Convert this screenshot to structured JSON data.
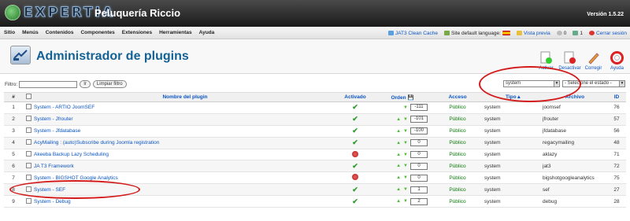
{
  "app": {
    "logo_text": "EXPERTIA",
    "site_name": "Peluquería Riccio",
    "version": "Versión 1.5.22"
  },
  "menu": [
    "Sitio",
    "Menús",
    "Contenidos",
    "Componentes",
    "Extensiones",
    "Herramientas",
    "Ayuda"
  ],
  "status": {
    "clean_cache": "JAT3 Clean Cache",
    "default_language": "Site default language:",
    "preview": "Vista previa",
    "messages": "0",
    "users": "1",
    "logout": "Cerrar sesión"
  },
  "page": {
    "title": "Administrador de plugins"
  },
  "toolbar": {
    "activate": "Activar",
    "deactivate": "Desactivar",
    "edit": "Corregir",
    "help": "Ayuda"
  },
  "filter": {
    "label": "Filtro:",
    "value": "",
    "go": "Ir",
    "reset": "Limpiar filtro",
    "type_selected": "system",
    "state_selected": "- Selecione el estado -"
  },
  "table": {
    "headers": {
      "num": "#",
      "name": "Nombre del plugin",
      "enabled": "Activado",
      "order": "Orden",
      "access": "Acceso",
      "type": "Tipo",
      "file": "Archivo",
      "id": "ID"
    },
    "rows": [
      {
        "num": "1",
        "name": "System - ARTIO JoomSEF",
        "enabled": true,
        "order": "-111",
        "access": "Público",
        "type": "system",
        "file": "joomsef",
        "id": "76",
        "up": false,
        "down": true
      },
      {
        "num": "2",
        "name": "System - Jfrouter",
        "enabled": true,
        "order": "-101",
        "access": "Público",
        "type": "system",
        "file": "jfrouter",
        "id": "57",
        "up": true,
        "down": true
      },
      {
        "num": "3",
        "name": "System - Jfdatabase",
        "enabled": true,
        "order": "-100",
        "access": "Público",
        "type": "system",
        "file": "jfdatabase",
        "id": "56",
        "up": true,
        "down": true
      },
      {
        "num": "4",
        "name": "AcyMailing : (auto)Subscribe during Joomla registration",
        "enabled": true,
        "order": "0",
        "access": "Público",
        "type": "system",
        "file": "regacymailing",
        "id": "48",
        "up": true,
        "down": true
      },
      {
        "num": "5",
        "name": "Akeeba Backup Lazy Scheduling",
        "enabled": false,
        "order": "0",
        "access": "Público",
        "type": "system",
        "file": "aklazy",
        "id": "71",
        "up": true,
        "down": true
      },
      {
        "num": "6",
        "name": "JA T3 Framework",
        "enabled": true,
        "order": "0",
        "access": "Público",
        "type": "system",
        "file": "jat3",
        "id": "72",
        "up": true,
        "down": true
      },
      {
        "num": "7",
        "name": "System - BIGSHOT Google Analytics",
        "enabled": false,
        "order": "0",
        "access": "Público",
        "type": "system",
        "file": "bigshotgoogleanalytics",
        "id": "75",
        "up": true,
        "down": true
      },
      {
        "num": "8",
        "name": "System - SEF",
        "enabled": true,
        "order": "1",
        "access": "Público",
        "type": "system",
        "file": "sef",
        "id": "27",
        "up": true,
        "down": true
      },
      {
        "num": "9",
        "name": "System - Debug",
        "enabled": true,
        "order": "2",
        "access": "Público",
        "type": "system",
        "file": "debug",
        "id": "28",
        "up": true,
        "down": true
      }
    ]
  }
}
